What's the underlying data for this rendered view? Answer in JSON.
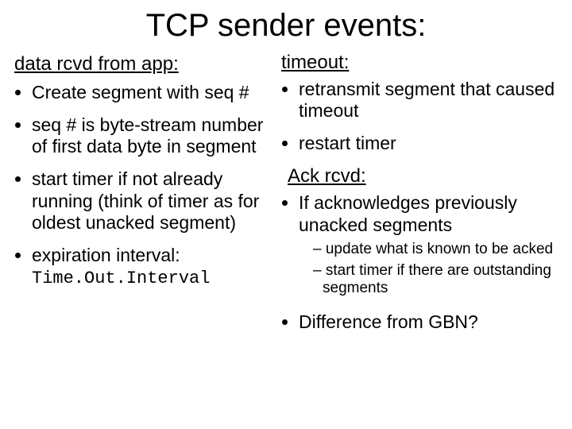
{
  "title": "TCP sender events:",
  "left": {
    "heading": "data rcvd from app:",
    "items": [
      "Create segment with seq #",
      "seq # is byte-stream number of first data byte in  segment",
      "start timer if not already running (think of timer as for oldest unacked segment)",
      "expiration interval:"
    ],
    "code": "Time.Out.Interval"
  },
  "right": {
    "heading1": "timeout:",
    "items1": [
      "retransmit segment that caused timeout",
      "restart timer"
    ],
    "heading2": "Ack rcvd:",
    "items2": [
      "If acknowledges previously unacked segments"
    ],
    "sub": [
      "update what is known to be acked",
      "start timer if there are outstanding segments"
    ],
    "diff": "Difference from GBN?"
  }
}
